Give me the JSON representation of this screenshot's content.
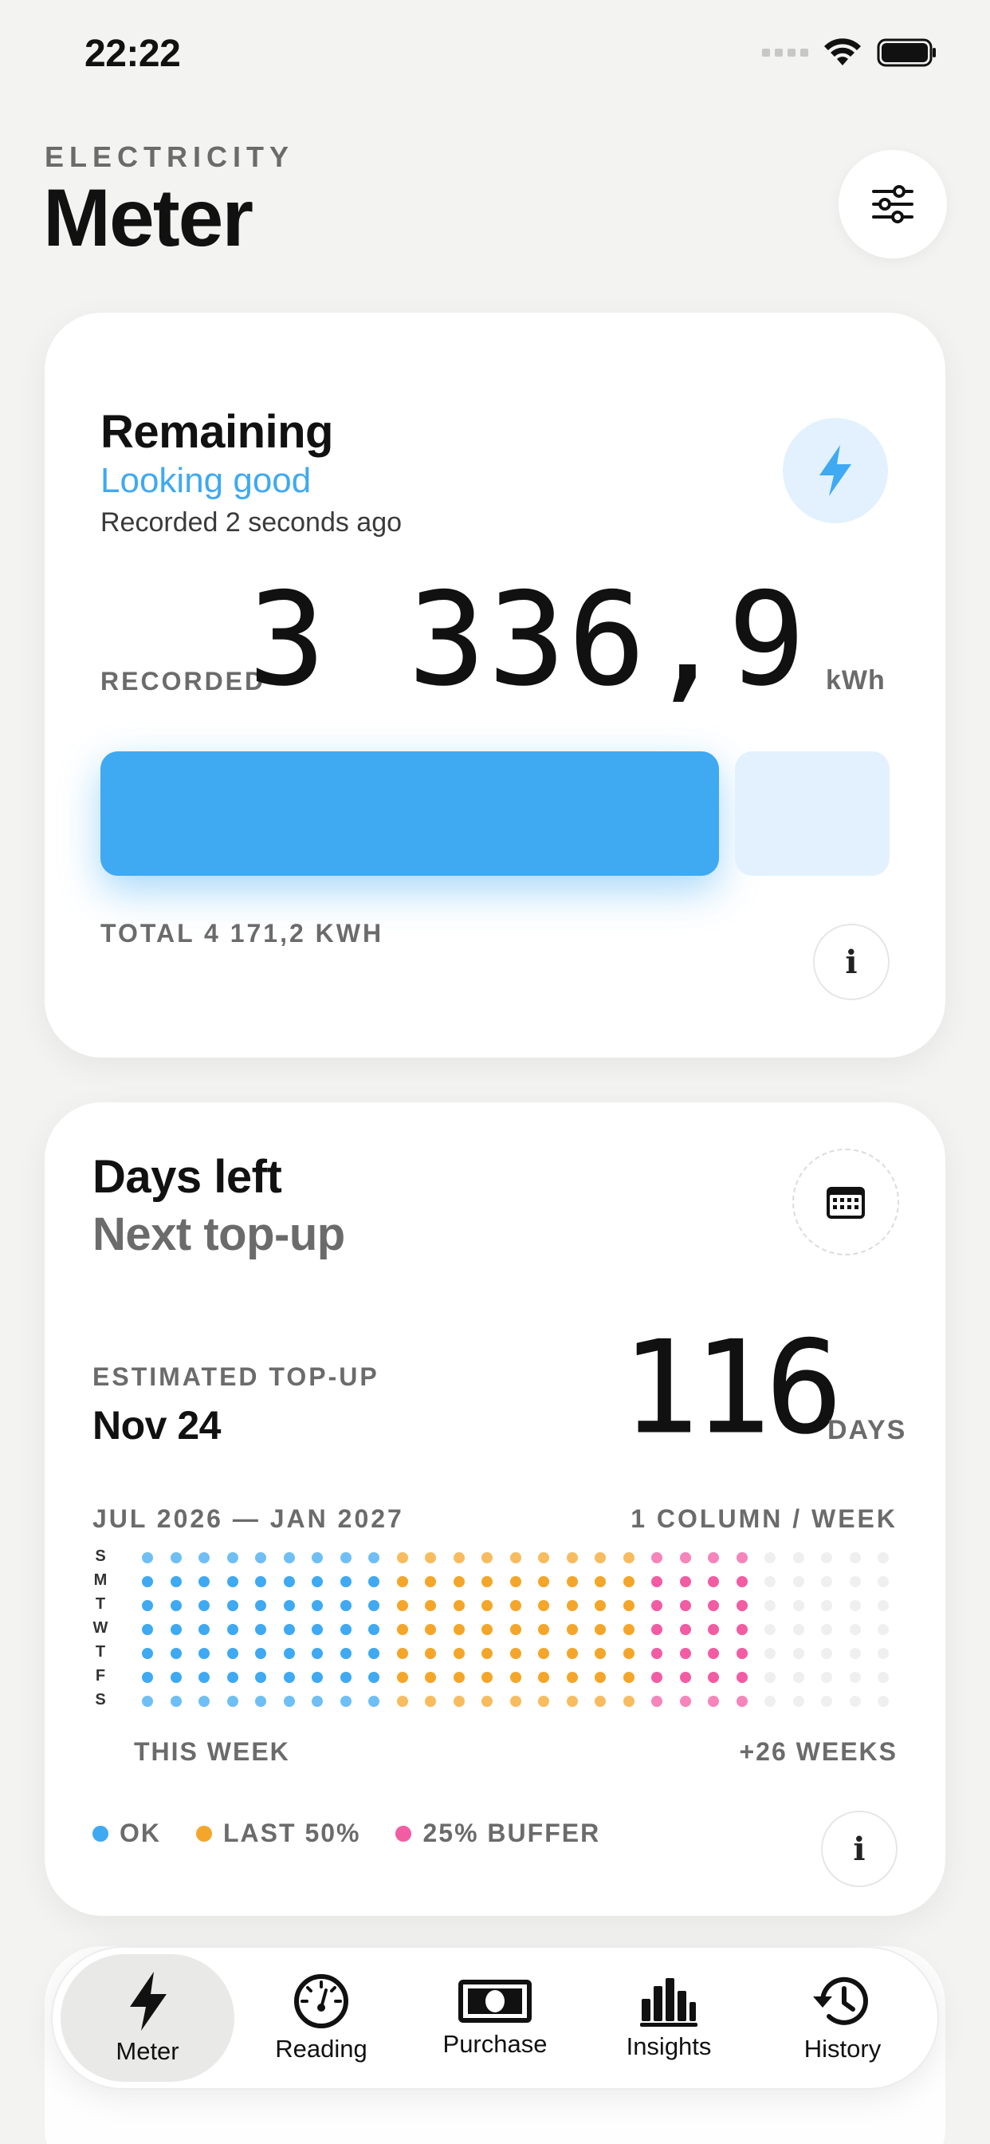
{
  "status_bar": {
    "time": "22:22"
  },
  "header": {
    "eyebrow": "ELECTRICITY",
    "title": "Meter"
  },
  "remaining_card": {
    "title": "Remaining",
    "status": "Looking good",
    "recorded_ago": "Recorded 2 seconds ago",
    "recorded_label": "RECORDED",
    "value": "3 336,9",
    "unit": "kWh",
    "total": "TOTAL 4 171,2 KWH",
    "fill_fraction": 0.8
  },
  "days_card": {
    "title": "Days left",
    "subtitle": "Next top-up",
    "estimate_label": "ESTIMATED TOP-UP",
    "estimate_date": "Nov 24",
    "days_value": "116",
    "days_unit": "DAYS",
    "range_label": "JUL 2026 — JAN 2027",
    "grid_hint": "1 COLUMN / WEEK",
    "start_label": "THIS WEEK",
    "end_label": "+26 WEEKS",
    "weekdays": [
      "S",
      "M",
      "T",
      "W",
      "T",
      "F",
      "S"
    ],
    "weeks": 27,
    "segments": {
      "ok_weeks": 9,
      "last50_weeks": 9,
      "buffer_weeks": 4
    },
    "colors": {
      "ok": "#3fa9f2",
      "last50": "#f4a62a",
      "buffer": "#f25ca3",
      "empty": "#efefef"
    },
    "legend": [
      {
        "label": "OK",
        "color": "#3fa9f2"
      },
      {
        "label": "LAST 50%",
        "color": "#f4a62a"
      },
      {
        "label": "25% BUFFER",
        "color": "#f25ca3"
      }
    ]
  },
  "tab_bar": {
    "tabs": [
      {
        "label": "Meter",
        "icon": "bolt-icon",
        "active": true
      },
      {
        "label": "Reading",
        "icon": "gauge-icon",
        "active": false
      },
      {
        "label": "Purchase",
        "icon": "banknote-icon",
        "active": false
      },
      {
        "label": "Insights",
        "icon": "bar-chart-icon",
        "active": false
      },
      {
        "label": "History",
        "icon": "clock-history-icon",
        "active": false
      }
    ]
  },
  "accent_color": "#3fa9f2"
}
